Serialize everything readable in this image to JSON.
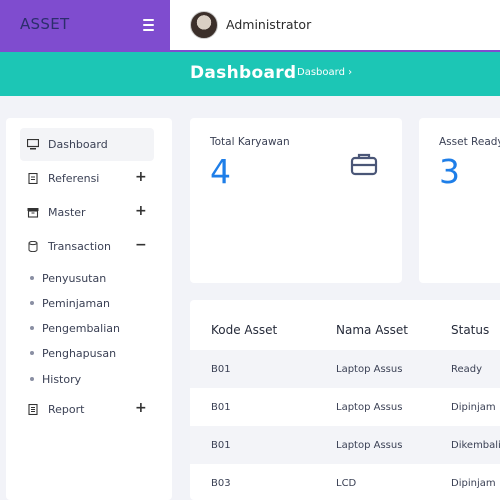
{
  "brand": {
    "name": "ASSET"
  },
  "topbar": {
    "user_name": "Administrator"
  },
  "hero": {
    "title": "Dashboard",
    "breadcrumb": "Dasboard ›"
  },
  "sidebar": {
    "items": [
      {
        "label": "Dashboard",
        "icon": "monitor-icon",
        "active": true
      },
      {
        "label": "Referensi",
        "icon": "document-icon",
        "toggle": "+"
      },
      {
        "label": "Master",
        "icon": "archive-icon",
        "toggle": "+"
      },
      {
        "label": "Transaction",
        "icon": "database-icon",
        "toggle": "−"
      },
      {
        "label": "Report",
        "icon": "report-icon",
        "toggle": "+"
      }
    ],
    "sub_items": [
      "Penyusutan",
      "Peminjaman",
      "Pengembalian",
      "Penghapusan",
      "History"
    ]
  },
  "cards": [
    {
      "title": "Total Karyawan",
      "value": "4",
      "icon": "briefcase-icon"
    },
    {
      "title": "Asset Ready",
      "value": "3"
    }
  ],
  "table": {
    "headers": [
      "Kode Asset",
      "Nama Asset",
      "Status"
    ],
    "rows": [
      [
        "B01",
        "Laptop Assus",
        "Ready"
      ],
      [
        "B01",
        "Laptop Assus",
        "Dipinjam"
      ],
      [
        "B01",
        "Laptop Assus",
        "Dikembali"
      ],
      [
        "B03",
        "LCD",
        "Dipinjam"
      ]
    ]
  },
  "colors": {
    "brand": "#7f4ccf",
    "hero": "#1cc6b5",
    "accent_value": "#1e7ee8"
  }
}
